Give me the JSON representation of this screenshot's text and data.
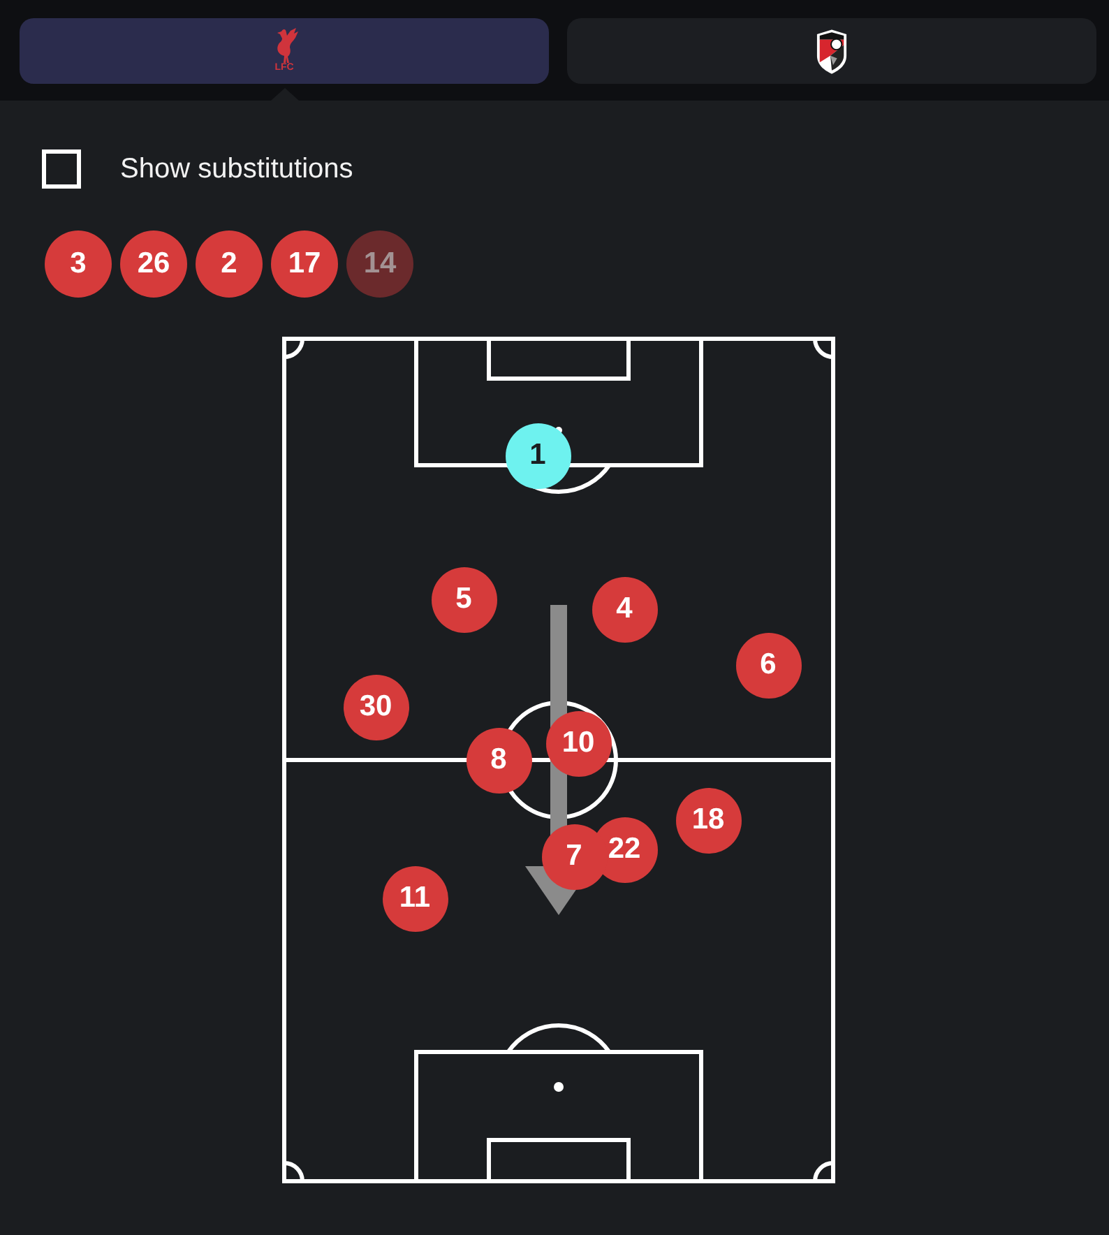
{
  "team_tabs": [
    {
      "kind": "bird",
      "crest_text": "LFC",
      "selected": true
    },
    {
      "kind": "shield",
      "selected": false
    }
  ],
  "substitutions_toggle": {
    "label": "Show substitutions",
    "checked": false
  },
  "substitutes": [
    {
      "number": "3",
      "disabled": false
    },
    {
      "number": "26",
      "disabled": false
    },
    {
      "number": "2",
      "disabled": false
    },
    {
      "number": "17",
      "disabled": false
    },
    {
      "number": "14",
      "disabled": true
    }
  ],
  "pitch": {
    "players": [
      {
        "number": "1",
        "color": "#6ef2ef"
      },
      {
        "number": "5",
        "color": "#d63b3b"
      },
      {
        "number": "4",
        "color": "#d63b3b"
      },
      {
        "number": "6",
        "color": "#d63b3b"
      },
      {
        "number": "30",
        "color": "#d63b3b"
      },
      {
        "number": "8",
        "color": "#d63b3b"
      },
      {
        "number": "10",
        "color": "#d63b3b"
      },
      {
        "number": "18",
        "color": "#d63b3b"
      },
      {
        "number": "22",
        "color": "#d63b3b"
      },
      {
        "number": "7",
        "color": "#d63b3b"
      },
      {
        "number": "11",
        "color": "#d63b3b"
      }
    ]
  }
}
